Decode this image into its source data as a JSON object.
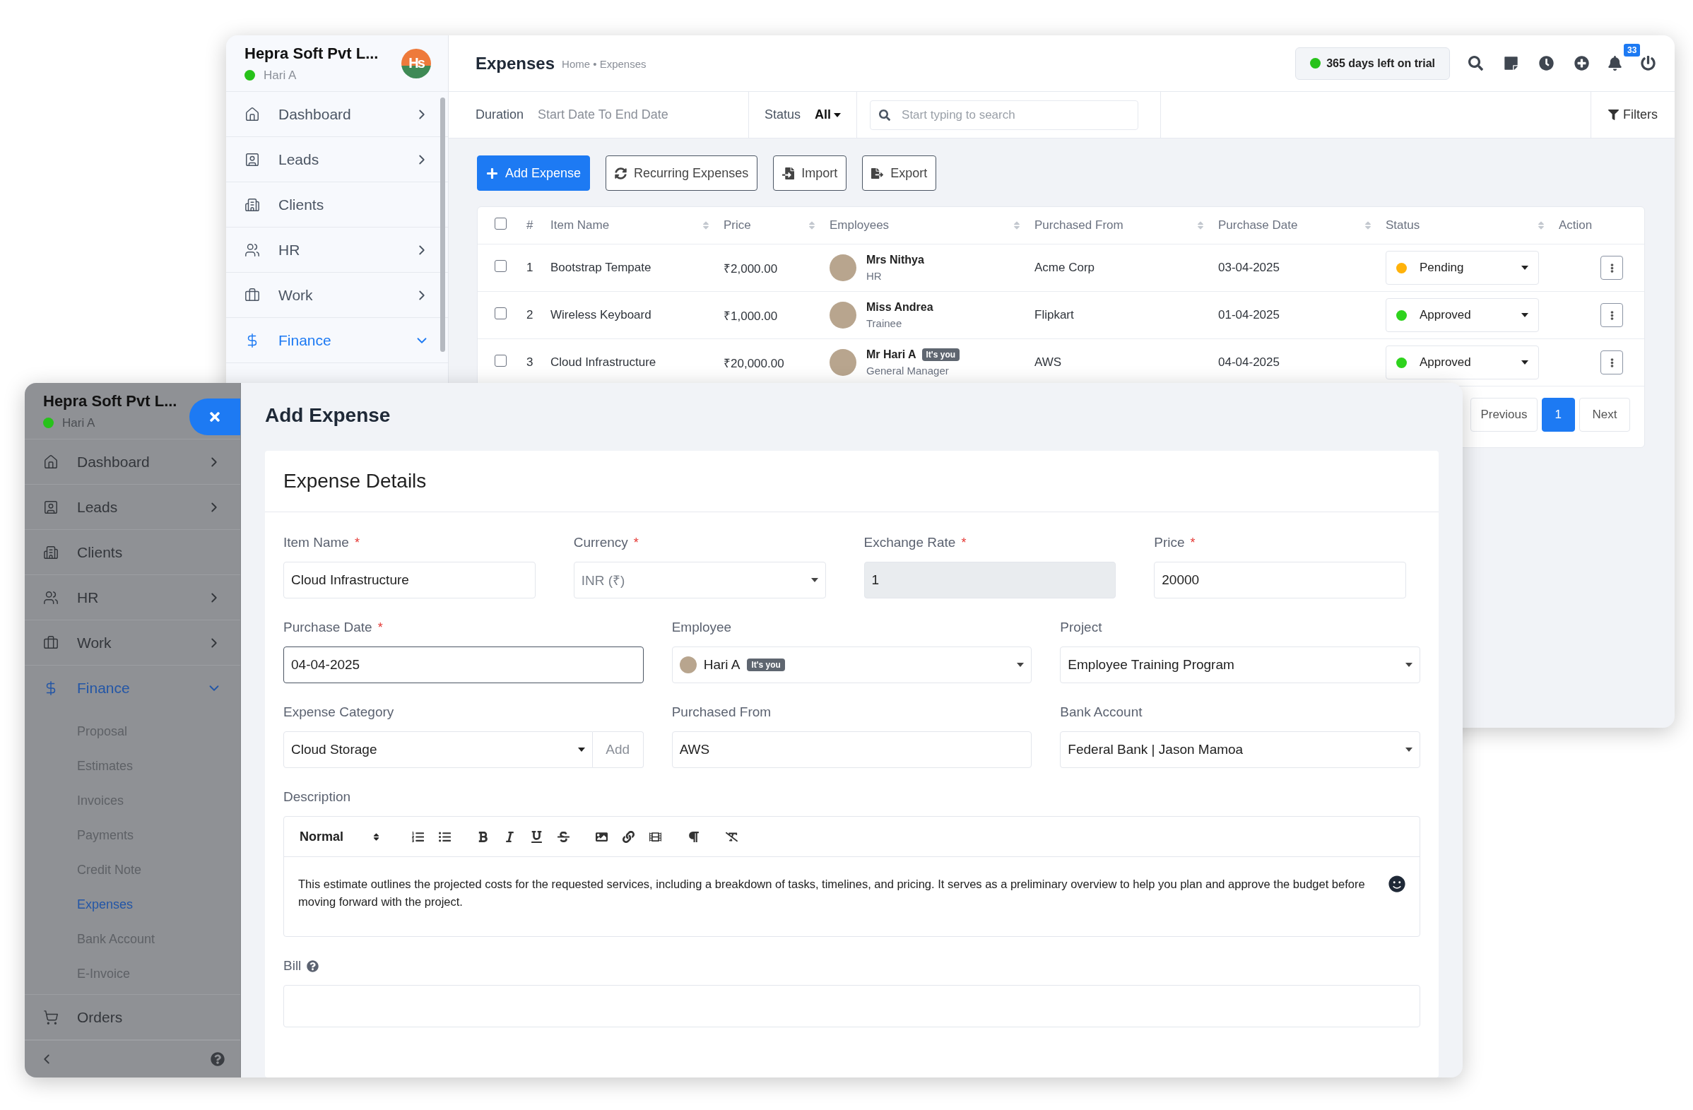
{
  "back_window": {
    "sidebar": {
      "company": "Hepra Soft Pvt L...",
      "user": "Hari A",
      "logo_text": "Hs",
      "items": [
        {
          "label": "Dashboard",
          "selected": false,
          "expanded": false
        },
        {
          "label": "Leads",
          "selected": false,
          "expanded": false
        },
        {
          "label": "Clients",
          "selected": false
        },
        {
          "label": "HR",
          "selected": false,
          "expanded": false
        },
        {
          "label": "Work",
          "selected": false,
          "expanded": false
        },
        {
          "label": "Finance",
          "selected": true,
          "expanded": true
        }
      ]
    },
    "header": {
      "title": "Expenses",
      "breadcrumb": "Home • Expenses",
      "trial": "365 days left on trial",
      "notification_count": "33"
    },
    "filters": {
      "duration_label": "Duration",
      "duration_value": "Start Date To End Date",
      "status_label": "Status",
      "status_value": "All",
      "search": {
        "placeholder": "Start typing to search"
      },
      "filters_button": "Filters"
    },
    "actions": [
      {
        "label": "Add Expense",
        "kind": "primary"
      },
      {
        "label": "Recurring Expenses",
        "kind": "outline"
      },
      {
        "label": "Import",
        "kind": "outline"
      },
      {
        "label": "Export",
        "kind": "outline"
      }
    ],
    "table": {
      "select_all": {
        "checked": false
      },
      "columns": [
        {
          "label": "#",
          "sortable": false
        },
        {
          "label": "Item Name",
          "sortable": true
        },
        {
          "label": "Price",
          "sortable": true
        },
        {
          "label": "Employees",
          "sortable": true
        },
        {
          "label": "Purchased From",
          "sortable": true
        },
        {
          "label": "Purchase Date",
          "sortable": true
        },
        {
          "label": "Status",
          "sortable": true
        },
        {
          "label": "Action",
          "sortable": false
        }
      ],
      "rows": [
        {
          "checked": false,
          "number": "1",
          "item": "Bootstrap Tempate",
          "price": "₹2,000.00",
          "employee": {
            "name": "Mrs Nithya",
            "role": "HR"
          },
          "purchased_from": "Acme Corp",
          "date": "03-04-2025",
          "status": {
            "label": "Pending",
            "color": "#ffb20a"
          }
        },
        {
          "checked": false,
          "number": "2",
          "item": "Wireless Keyboard",
          "price": "₹1,000.00",
          "employee": {
            "name": "Miss Andrea",
            "role": "Trainee"
          },
          "purchased_from": "Flipkart",
          "date": "01-04-2025",
          "status": {
            "label": "Approved",
            "color": "#2ed31d"
          }
        },
        {
          "checked": false,
          "number": "3",
          "item": "Cloud Infrastructure",
          "price": "₹20,000.00",
          "employee": {
            "name": "Mr Hari A",
            "role": "General Manager",
            "badge": "It's you"
          },
          "purchased_from": "AWS",
          "date": "04-04-2025",
          "status": {
            "label": "Approved",
            "color": "#2ed31d"
          }
        }
      ]
    },
    "pagination": [
      {
        "label": "Previous",
        "selected": false
      },
      {
        "label": "1",
        "selected": true
      },
      {
        "label": "Next",
        "selected": false
      }
    ]
  },
  "front_window": {
    "sidebar": {
      "company": "Hepra Soft Pvt L...",
      "user": "Hari A",
      "items": [
        {
          "label": "Dashboard",
          "selected": false,
          "expanded": false
        },
        {
          "label": "Leads",
          "selected": false,
          "expanded": false
        },
        {
          "label": "Clients",
          "selected": false
        },
        {
          "label": "HR",
          "selected": false,
          "expanded": false
        },
        {
          "label": "Work",
          "selected": false,
          "expanded": false
        },
        {
          "label": "Finance",
          "selected": true,
          "expanded": true,
          "children": [
            {
              "label": "Proposal",
              "selected": false
            },
            {
              "label": "Estimates",
              "selected": false
            },
            {
              "label": "Invoices",
              "selected": false
            },
            {
              "label": "Payments",
              "selected": false
            },
            {
              "label": "Credit Note",
              "selected": false
            },
            {
              "label": "Expenses",
              "selected": true
            },
            {
              "label": "Bank Account",
              "selected": false
            },
            {
              "label": "E-Invoice",
              "selected": false
            }
          ]
        },
        {
          "label": "Orders",
          "selected": false
        }
      ]
    },
    "page_title": "Add Expense",
    "card_title": "Expense Details",
    "form_rows": [
      [
        {
          "label": "Item Name",
          "required_mark": "*",
          "kind": "text",
          "value": "Cloud Infrastructure"
        },
        {
          "label": "Currency",
          "required_mark": "*",
          "kind": "select",
          "value": "INR (₹)",
          "disabled": true
        },
        {
          "label": "Exchange Rate",
          "required_mark": "*",
          "kind": "text",
          "value": "1",
          "disabled": true
        },
        {
          "label": "Price",
          "required_mark": "*",
          "kind": "text",
          "value": "20000"
        }
      ],
      [
        {
          "label": "Purchase Date",
          "required_mark": "*",
          "kind": "text",
          "value": "04-04-2025",
          "focused": true
        },
        {
          "label": "Employee",
          "kind": "person",
          "value": "Hari A",
          "badge": "It's you"
        },
        {
          "label": "Project",
          "kind": "select",
          "value": "Employee Training Program"
        }
      ],
      [
        {
          "label": "Expense Category",
          "kind": "select_add",
          "value": "Cloud Storage",
          "add_label": "Add"
        },
        {
          "label": "Purchased From",
          "kind": "text",
          "value": "AWS"
        },
        {
          "label": "Bank Account",
          "kind": "select",
          "value": "Federal Bank | Jason Mamoa"
        }
      ]
    ],
    "description": {
      "label": "Description",
      "heading_select": "Normal",
      "text": "This estimate outlines the projected costs for the requested services, including a breakdown of tasks, timelines, and pricing. It serves as a preliminary overview to help you plan and approve the budget before moving forward with the project."
    },
    "bill": {
      "label": "Bill"
    }
  }
}
